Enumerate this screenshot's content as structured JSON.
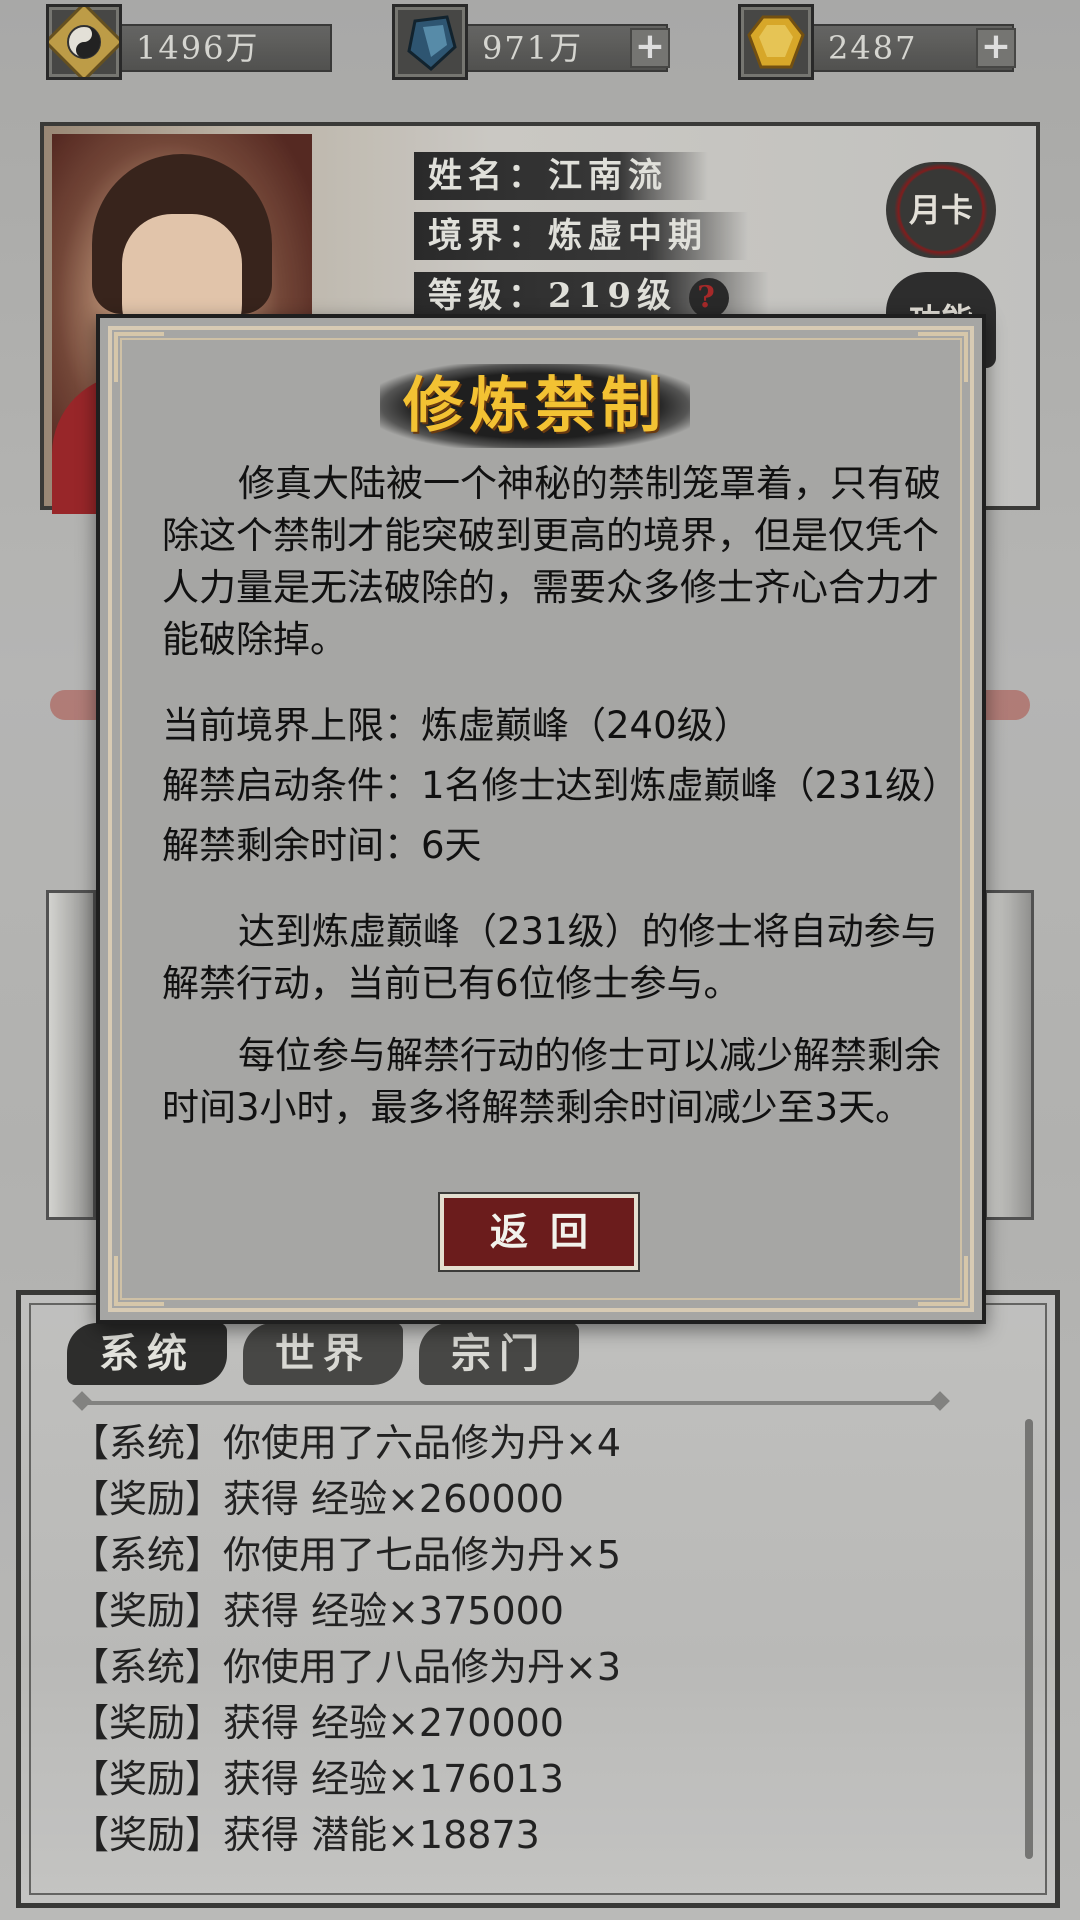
{
  "resources": [
    {
      "icon": "yin-yang-coin-icon",
      "value": "1496万",
      "has_plus": false
    },
    {
      "icon": "blue-crystal-icon",
      "value": "971万",
      "has_plus": true
    },
    {
      "icon": "gold-gem-icon",
      "value": "2487",
      "has_plus": true
    }
  ],
  "plus_symbol": "+",
  "character": {
    "name": "姓名：江南流",
    "realm": "境界：炼虚中期",
    "level": "等级：219级",
    "help": "?",
    "month_card": "月卡",
    "function": "功能"
  },
  "modal": {
    "title": "修炼禁制",
    "intro": "修真大陆被一个神秘的禁制笼罩着，只有破除这个禁制才能突破到更高的境界，但是仅凭个人力量是无法破除的，需要众多修士齐心合力才能破除掉。",
    "stats": [
      "当前境界上限：炼虚巅峰（240级）",
      "解禁启动条件：1名修士达到炼虚巅峰（231级）",
      "解禁剩余时间：6天"
    ],
    "para2": "达到炼虚巅峰（231级）的修士将自动参与解禁行动，当前已有6位修士参与。",
    "para3": "每位参与解禁行动的修士可以减少解禁剩余时间3小时，最多将解禁剩余时间减少至3天。",
    "back_label": "返回"
  },
  "chat": {
    "tabs": [
      "系统",
      "世界",
      "宗门"
    ],
    "lines": [
      "【系统】你使用了六品修为丹×4",
      "【奖励】获得 经验×260000",
      "【系统】你使用了七品修为丹×5",
      "【奖励】获得 经验×375000",
      "【系统】你使用了八品修为丹×3",
      "【奖励】获得 经验×270000",
      "【奖励】获得 经验×176013",
      "【奖励】获得 潜能×18873"
    ]
  }
}
